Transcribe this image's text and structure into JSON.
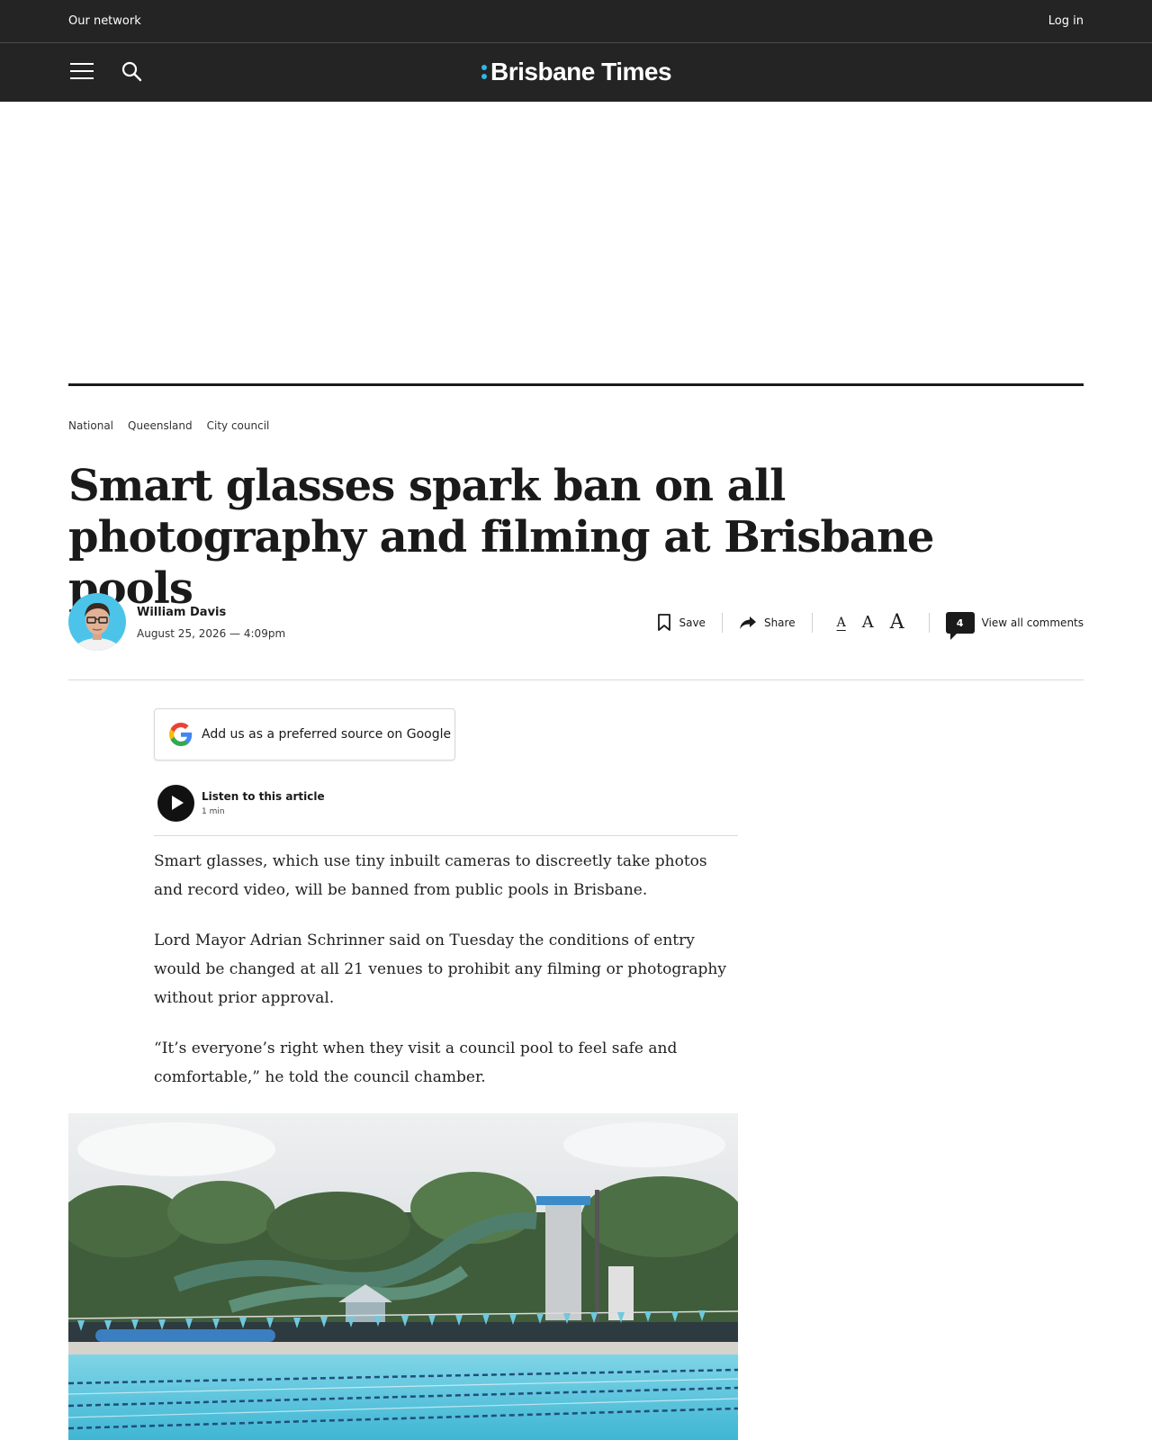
{
  "network": {
    "label": "Our network"
  },
  "account": {
    "login_label": "Log in"
  },
  "brand": {
    "name": "Brisbane Times",
    "accent": "#2fb6e8"
  },
  "nav": {
    "menu_icon": "hamburger-icon",
    "search_icon": "search-icon"
  },
  "breadcrumbs": [
    "National",
    "Queensland",
    "City council"
  ],
  "article": {
    "headline": "Smart glasses spark ban on all photography and filming at Brisbane pools",
    "author": "William Davis",
    "date": "August 25, 2026 — 4:09pm",
    "paragraphs": [
      "Smart glasses, which use tiny inbuilt cameras to discreetly take photos and record video, will be banned from public pools in Brisbane.",
      "Lord Mayor Adrian Schrinner said on Tuesday the conditions of entry would be changed at all 21 venues to prohibit any filming or photography without prior approval.",
      "“It’s everyone’s right when they visit a council pool to feel safe and comfortable,” he told the council chamber."
    ]
  },
  "tools": {
    "save_label": "Save",
    "share_label": "Share",
    "font_small": "A",
    "font_medium": "A",
    "font_large": "A",
    "comment_count": "4",
    "comments_label": "View all comments"
  },
  "google": {
    "label": "Add us as a preferred source on Google"
  },
  "audio": {
    "title": "Listen to this article",
    "duration": "1 min"
  }
}
